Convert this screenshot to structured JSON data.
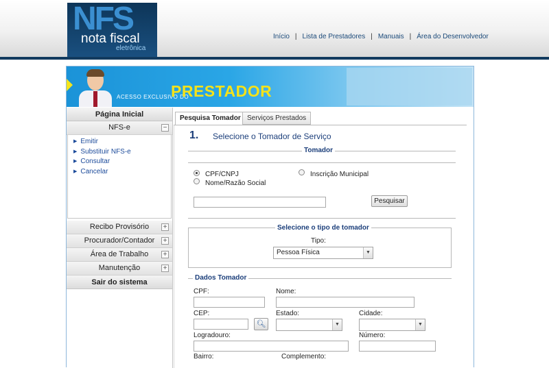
{
  "header": {
    "logo": {
      "nfs": "NFS",
      "nota": "nota fiscal",
      "sub": "eletrônica"
    },
    "nav": [
      {
        "label": "Início"
      },
      {
        "label": "Lista de Prestadores"
      },
      {
        "label": "Manuais"
      },
      {
        "label": "Área do Desenvolvedor"
      }
    ],
    "separator": "|"
  },
  "banner": {
    "exclusive": "ACESSO EXCLUSIVO DO",
    "title": "PRESTADOR",
    "arrow_color": "#f6e51a",
    "title_color": "#f4e21a"
  },
  "sidebar": {
    "home": "Página Inicial",
    "nfse": {
      "label": "NFS-e",
      "toggle": "−",
      "links": [
        "Emitir",
        "Substituir NFS-e",
        "Consultar",
        "Cancelar"
      ]
    },
    "sections": [
      {
        "label": "Recibo Provisório",
        "toggle": "+"
      },
      {
        "label": "Procurador/Contador",
        "toggle": "+"
      },
      {
        "label": "Área de Trabalho",
        "toggle": "+"
      },
      {
        "label": "Manutenção",
        "toggle": "+"
      }
    ],
    "logout": "Sair do sistema"
  },
  "tabs": [
    {
      "label": "Pesquisa Tomador",
      "active": true
    },
    {
      "label": "Serviços Prestados",
      "active": false
    }
  ],
  "step": {
    "number": "1.",
    "title": "Selecione o Tomador de Serviço"
  },
  "tomador": {
    "legend": "Tomador",
    "options": [
      {
        "label": "CPF/CNPJ",
        "selected": true
      },
      {
        "label": "Inscrição Municipal",
        "selected": false
      },
      {
        "label": "Nome/Razão Social",
        "selected": false
      }
    ],
    "search_value": "",
    "search_button": "Pesquisar"
  },
  "tipo": {
    "legend": "Selecione o tipo de tomador",
    "label": "Tipo:",
    "selected": "Pessoa Física"
  },
  "dados": {
    "legend": "Dados Tomador",
    "fields": {
      "cpf": "CPF:",
      "nome": "Nome:",
      "cep": "CEP:",
      "estado": "Estado:",
      "cidade": "Cidade:",
      "logradouro": "Logradouro:",
      "numero": "Número:",
      "bairro": "Bairro:",
      "complemento": "Complemento:"
    }
  },
  "icons": {
    "dropdown": "chevron-down-icon",
    "search": "magnifier-icon",
    "bullet": "triangle-right-icon"
  }
}
